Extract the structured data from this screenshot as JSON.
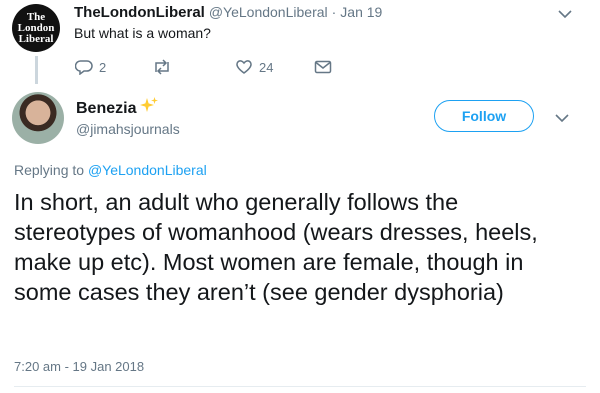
{
  "parent_tweet": {
    "avatar_lines": [
      "The",
      "London",
      "Liberal"
    ],
    "display_name": "TheLondonLiberal",
    "handle": "@YeLondonLiberal",
    "separator": "·",
    "date": "Jan 19",
    "text": "But what is a woman?",
    "reply_count": "2",
    "retweet_count": "",
    "like_count": "24"
  },
  "reply_tweet": {
    "display_name": "Benezia",
    "name_emoji": "✨",
    "handle": "@jimahsjournals",
    "follow_label": "Follow",
    "replying_prefix": "Replying to ",
    "replying_handle": "@YeLondonLiberal",
    "text": "In short, an adult who generally follows the stereotypes of womanhood (wears dresses, heels, make up etc). Most women are female, though in some cases they aren’t (see gender dysphoria)",
    "timestamp": "7:20 am - 19 Jan 2018"
  },
  "colors": {
    "accent": "#1da1f2",
    "secondary_text": "#657786",
    "sparkle": "#ffcc33"
  },
  "icons": [
    "reply-icon",
    "retweet-icon",
    "like-icon",
    "message-icon",
    "chevron-down-icon",
    "sparkles-icon"
  ]
}
